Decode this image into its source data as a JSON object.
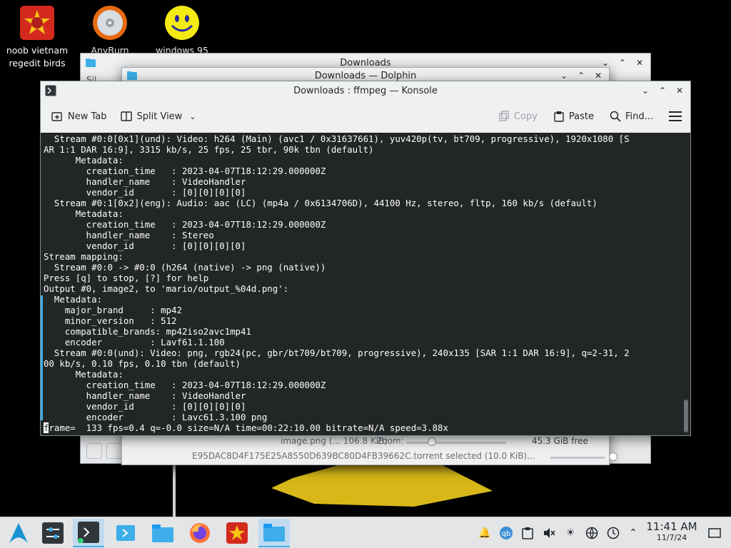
{
  "desktop": {
    "icons": [
      {
        "label": "noob vietnam regedit birds"
      },
      {
        "label": "AnyBurn"
      },
      {
        "label": "windows 95"
      }
    ]
  },
  "windows": {
    "downloads_back": {
      "title": "Downloads",
      "partial_text": "Sil"
    },
    "dolphin": {
      "title": "Downloads — Dolphin",
      "status_file": "image.png (... 106.8 KiB)",
      "zoom_label": "Zoom:",
      "free_space": "45.3 GiB free",
      "selected_file": "E95DAC8D4F175E25A8550D639BC80D4FB39662C.torrent  selected (10.0 KiB)..."
    }
  },
  "konsole": {
    "title": "Downloads : ffmpeg — Konsole",
    "toolbar": {
      "new_tab": "New Tab",
      "split_view": "Split View",
      "copy": "Copy",
      "paste": "Paste",
      "find": "Find..."
    },
    "lines": [
      "  Stream #0:0[0x1](und): Video: h264 (Main) (avc1 / 0x31637661), yuv420p(tv, bt709, progressive), 1920x1080 [S",
      "AR 1:1 DAR 16:9], 3315 kb/s, 25 fps, 25 tbr, 90k tbn (default)",
      "      Metadata:",
      "        creation_time   : 2023-04-07T18:12:29.000000Z",
      "        handler_name    : VideoHandler",
      "        vendor_id       : [0][0][0][0]",
      "  Stream #0:1[0x2](eng): Audio: aac (LC) (mp4a / 0x6134706D), 44100 Hz, stereo, fltp, 160 kb/s (default)",
      "      Metadata:",
      "        creation_time   : 2023-04-07T18:12:29.000000Z",
      "        handler_name    : Stereo",
      "        vendor_id       : [0][0][0][0]",
      "Stream mapping:",
      "  Stream #0:0 -> #0:0 (h264 (native) -> png (native))",
      "Press [q] to stop, [?] for help",
      "Output #0, image2, to 'mario/output_%04d.png':",
      "  Metadata:",
      "    major_brand     : mp42",
      "    minor_version   : 512",
      "    compatible_brands: mp42iso2avc1mp41",
      "    encoder         : Lavf61.1.100",
      "  Stream #0:0(und): Video: png, rgb24(pc, gbr/bt709/bt709, progressive), 240x135 [SAR 1:1 DAR 16:9], q=2-31, 2",
      "00 kb/s, 0.10 fps, 0.10 tbn (default)",
      "      Metadata:",
      "        creation_time   : 2023-04-07T18:12:29.000000Z",
      "        handler_name    : VideoHandler",
      "        vendor_id       : [0][0][0][0]",
      "        encoder         : Lavc61.3.100 png"
    ],
    "progress_cursor_char": "f",
    "progress_rest": "rame=  133 fps=0.4 q=-0.0 size=N/A time=00:22:10.00 bitrate=N/A speed=3.88x"
  },
  "taskbar": {
    "clock_time": "11:41 AM",
    "clock_date": "11/7/24"
  },
  "colors": {
    "terminal_bg": "#232627",
    "terminal_fg": "#fcfcfc",
    "accent": "#3daee9"
  }
}
